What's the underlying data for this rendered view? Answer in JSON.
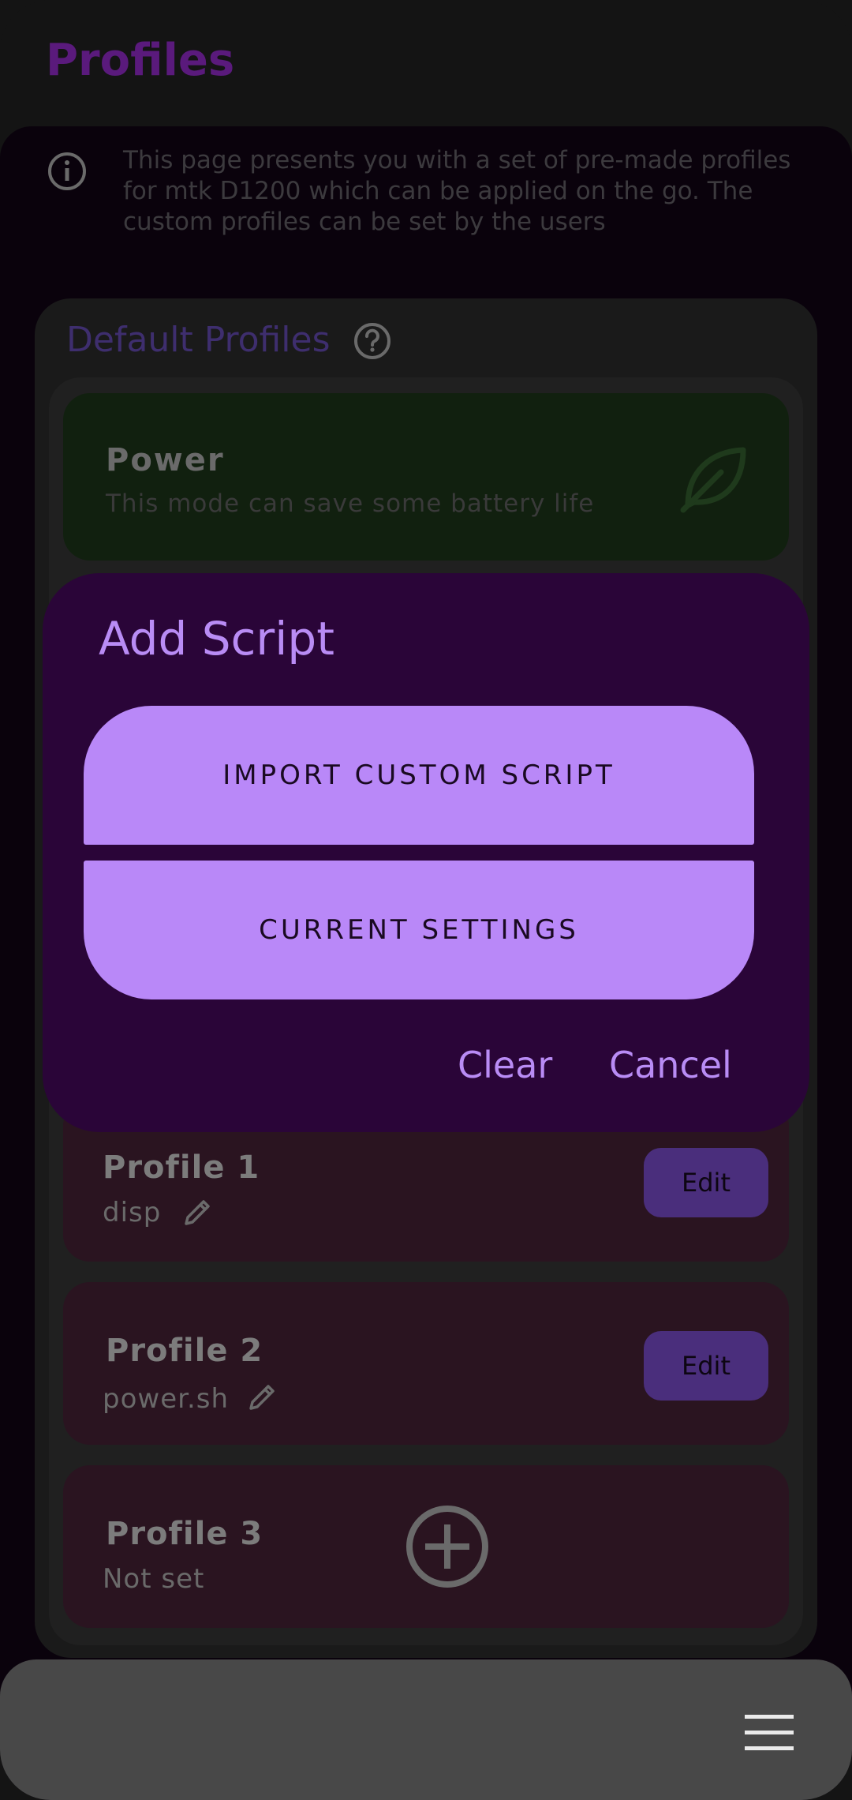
{
  "header": {
    "title": "Profiles"
  },
  "info": {
    "icon": "info-icon",
    "text": "This page presents you with a set of pre-made profiles for mtk D1200 which can be applied on the go. The custom profiles can be set by the users"
  },
  "default_profiles": {
    "title": "Default Profiles",
    "help_icon": "help-icon",
    "power": {
      "title": "Power",
      "subtitle": "This mode can save some battery life",
      "icon": "leaf-icon"
    }
  },
  "custom_profiles": [
    {
      "title": "Profile 1",
      "script": "disp",
      "edit_label": "Edit"
    },
    {
      "title": "Profile 2",
      "script": "power.sh",
      "edit_label": "Edit"
    },
    {
      "title": "Profile 3",
      "script": "Not set"
    }
  ],
  "dialog": {
    "title": "Add Script",
    "import_label": "IMPORT CUSTOM SCRIPT",
    "current_label": "CURRENT SETTINGS",
    "clear_label": "Clear",
    "cancel_label": "Cancel"
  },
  "bottom_bar": {
    "menu_icon": "menu-icon"
  },
  "colors": {
    "accent": "#b988f8",
    "dialog_bg": "#2a0538",
    "title": "#5a1a7c"
  }
}
